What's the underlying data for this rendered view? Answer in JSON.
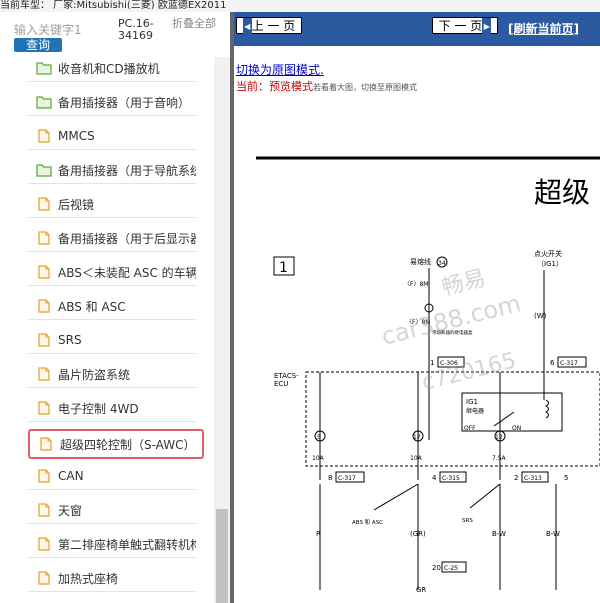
{
  "vehicle_bar": {
    "text": "当前车型：  厂家:Mitsubishi(三菱)  欧蓝德EX2011"
  },
  "left_panel": {
    "search_placeholder": "输入关键字1",
    "search_button": "查询",
    "pc_code": "PC.16-34169",
    "collapse_all": "折叠全部",
    "tree_items": [
      {
        "label": "收音机和CD播放机",
        "icon": "folder-icon"
      },
      {
        "label": "备用插接器（用于音响）",
        "icon": "folder-icon"
      },
      {
        "label": "MMCS",
        "icon": "document-icon"
      },
      {
        "label": "备用插接器（用于导航系统）",
        "icon": "folder-icon"
      },
      {
        "label": "后视镜",
        "icon": "document-icon"
      },
      {
        "label": "备用插接器（用于后显示器）",
        "icon": "document-icon"
      },
      {
        "label": "ABS＜未装配 ASC 的车辆＞",
        "icon": "document-icon"
      },
      {
        "label": "ABS 和 ASC",
        "icon": "document-icon"
      },
      {
        "label": "SRS",
        "icon": "document-icon"
      },
      {
        "label": "晶片防盗系统",
        "icon": "document-icon"
      },
      {
        "label": "电子控制 4WD",
        "icon": "document-icon"
      },
      {
        "label": "超级四轮控制（S-AWC）",
        "icon": "document-icon",
        "selected": true
      },
      {
        "label": "CAN",
        "icon": "document-icon"
      },
      {
        "label": "天窗",
        "icon": "document-icon"
      },
      {
        "label": "第二排座椅单触式翻转机构",
        "icon": "document-icon"
      },
      {
        "label": "加热式座椅",
        "icon": "document-icon"
      }
    ]
  },
  "right_panel": {
    "prev_button": "上 一 页",
    "next_button": "下 一 页",
    "refresh_link": "[刷新当前页]",
    "switch_mode_link": "切换为原图模式.",
    "current_label": "当前：",
    "current_mode": "预览模式",
    "current_hint": "若看着大图，切换至原图模式"
  },
  "diagram": {
    "title_partial": "超级",
    "box_number": "1",
    "watermark_lines": [
      "畅易",
      "car388.com",
      "c720165"
    ],
    "labels": {
      "battery_line": "易熔线",
      "fuse_34": "34",
      "ignition_switch": "点火开关",
      "ig1": "（IG1）",
      "f8m_1": "〈F〉8M",
      "f8m_2": "〈F〉8M",
      "relay_box": "带熔断器的继电器盒",
      "w": "(W)",
      "etacs": "ETACS-",
      "ecu": "ECU",
      "pin1": "1",
      "c306": "C-306",
      "pin6": "6",
      "c317_a": "C-317",
      "ig1_relay_1": "IG1",
      "ig1_relay_2": "继电器",
      "off": "OFF",
      "on": "ON",
      "n5": "5",
      "n17": "17",
      "n12": "12",
      "a10_1": "10A",
      "a10_2": "10A",
      "a75": "7.5A",
      "pin8": "8",
      "c317_b": "C-317",
      "pin4": "4",
      "c315": "C-315",
      "pin2": "2",
      "c313": "C-313",
      "pin5b": "5",
      "abs_asc": "ABS 和 ASC",
      "srs": "SRS",
      "r": "R",
      "gr1": "(GR)",
      "bw1": "B-W",
      "bw2": "B-W",
      "pin20": "20",
      "c25": "C-25",
      "gr2": "GR"
    }
  }
}
